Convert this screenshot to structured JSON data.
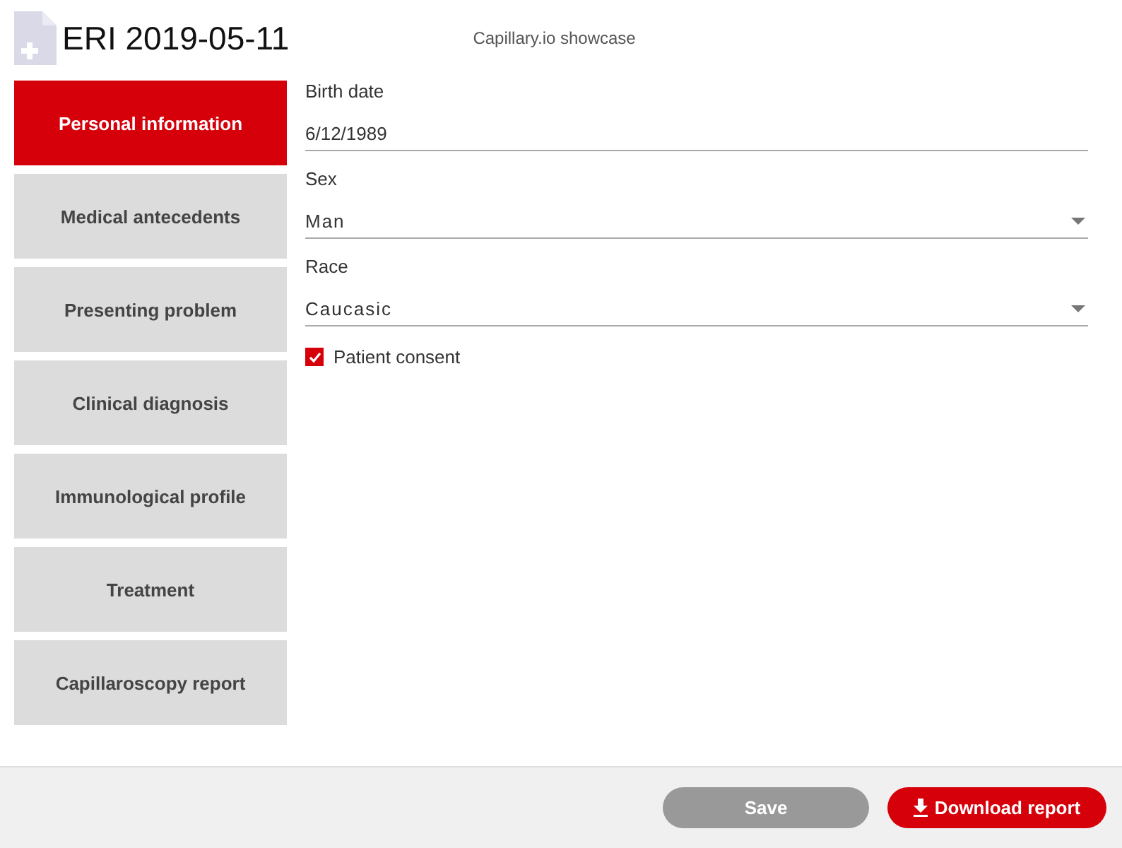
{
  "header": {
    "title": "ERI 2019-05-11",
    "subtitle": "Capillary.io showcase"
  },
  "sidebar": {
    "items": [
      {
        "label": "Personal information",
        "selected": true
      },
      {
        "label": "Medical antecedents",
        "selected": false
      },
      {
        "label": "Presenting problem",
        "selected": false
      },
      {
        "label": "Clinical diagnosis",
        "selected": false
      },
      {
        "label": "Immunological profile",
        "selected": false
      },
      {
        "label": "Treatment",
        "selected": false
      },
      {
        "label": "Capillaroscopy report",
        "selected": false
      }
    ]
  },
  "form": {
    "fields": [
      {
        "kind": "text",
        "label": "Birth date",
        "value": "6/12/1989"
      },
      {
        "kind": "select",
        "label": "Sex",
        "value": "Man"
      },
      {
        "kind": "select",
        "label": "Race",
        "value": "Caucasic"
      },
      {
        "kind": "checkbox",
        "label": "Patient consent",
        "checked": true
      }
    ]
  },
  "footer": {
    "buttons": [
      {
        "kind": "save",
        "label": "Save",
        "disabled": true
      },
      {
        "kind": "download",
        "label": "Download report",
        "disabled": false
      }
    ]
  }
}
